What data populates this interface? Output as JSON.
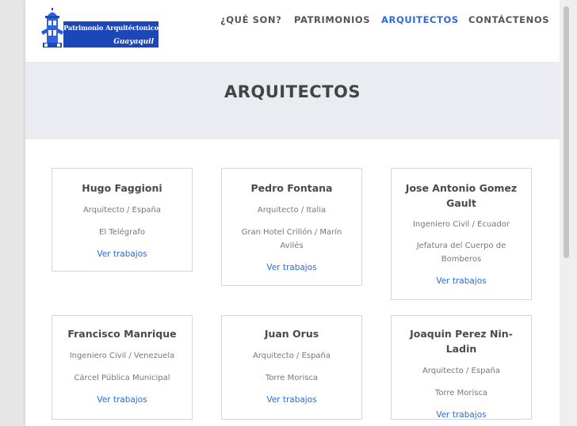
{
  "header": {
    "logo": {
      "line1": "Patrimonio Arquitéctonico",
      "line2": "Guayaquil"
    },
    "nav": [
      {
        "label": "¿QUÉ SON?"
      },
      {
        "label": "PATRIMONIOS"
      },
      {
        "label": "ARQUITECTOS",
        "active": true
      },
      {
        "label": "CONTÁCTENOS"
      }
    ]
  },
  "hero": {
    "title": "ARQUITECTOS"
  },
  "architects": [
    {
      "name": "Hugo Faggioni",
      "role": "Arquitecto / España",
      "work": "El Telégrafo",
      "link": "Ver trabajos"
    },
    {
      "name": "Pedro Fontana",
      "role": "Arquitecto / Italia",
      "work": "Gran Hotel Crillón / Marín Avilés",
      "link": "Ver trabajos"
    },
    {
      "name": "Jose Antonio Gomez Gault",
      "role": "Ingeniero Civil / Ecuador",
      "work": "Jefatura del Cuerpo de Bomberos",
      "link": "Ver trabajos"
    },
    {
      "name": "Francisco Manrique",
      "role": "Ingeniero Civil / Venezuela",
      "work": "Cárcel Pública Municipal",
      "link": "Ver trabajos"
    },
    {
      "name": "Juan Orus",
      "role": "Arquitecto / España",
      "work": "Torre Morisca",
      "link": "Ver trabajos"
    },
    {
      "name": "Joaquin Perez Nin-Ladin",
      "role": "Arquitecto / España",
      "work": "Torre Morisca",
      "link": "Ver trabajos"
    }
  ],
  "colors": {
    "accent": "#2f6ad9",
    "logo_blue": "#1c47b8",
    "hero_bg": "#eaecf1"
  }
}
